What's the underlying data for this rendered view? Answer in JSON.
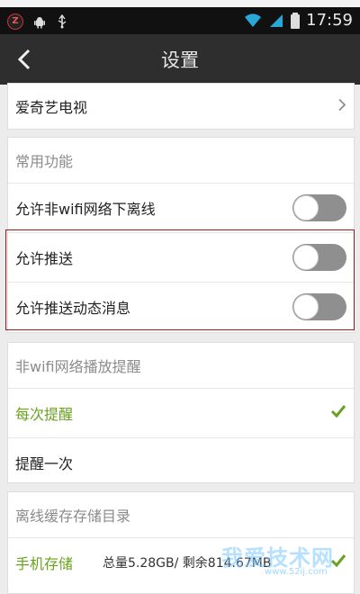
{
  "status_bar": {
    "time": "17:59"
  },
  "header": {
    "title": "设置"
  },
  "entry_card": {
    "label": "爱奇艺电视"
  },
  "common": {
    "title": "常用功能",
    "items": [
      {
        "label": "允许非wifi网络下离线",
        "toggle": "off"
      },
      {
        "label": "允许推送",
        "toggle": "off"
      },
      {
        "label": "允许推送动态消息",
        "toggle": "off"
      }
    ]
  },
  "non_wifi": {
    "title": "非wifi网络播放提醒",
    "items": [
      {
        "label": "每次提醒",
        "selected": true
      },
      {
        "label": "提醒一次",
        "selected": false
      }
    ]
  },
  "cache": {
    "title": "离线缓存存储目录",
    "phone_label": "手机存储",
    "phone_value": "总量5.28GB/ 剩余814.67MB"
  },
  "watermark": {
    "text": "我爱技术网",
    "url": "www.52ij.com"
  },
  "colors": {
    "accent_green": "#6aa21f",
    "toggle_off": "#8f8f8f",
    "highlight_red": "#9e1b1b",
    "titlebar": "#2e2e2e"
  }
}
